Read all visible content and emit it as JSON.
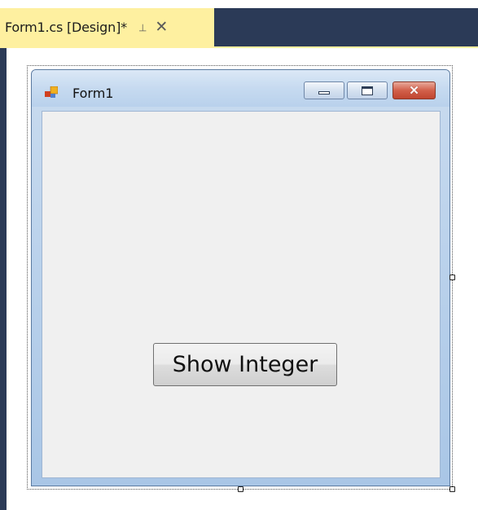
{
  "document_tab": {
    "title": "Form1.cs [Design]*",
    "pin_icon": "pin-icon",
    "close_icon": "close-icon"
  },
  "form": {
    "title": "Form1",
    "icon": "form-app-icon",
    "caption_buttons": [
      "minimize",
      "maximize",
      "close"
    ]
  },
  "button": {
    "label": "Show Integer"
  },
  "colors": {
    "ide_background": "#2b3a57",
    "active_tab": "#fef0a0",
    "form_client": "#f0f0f0",
    "close_button": "#c04530"
  }
}
